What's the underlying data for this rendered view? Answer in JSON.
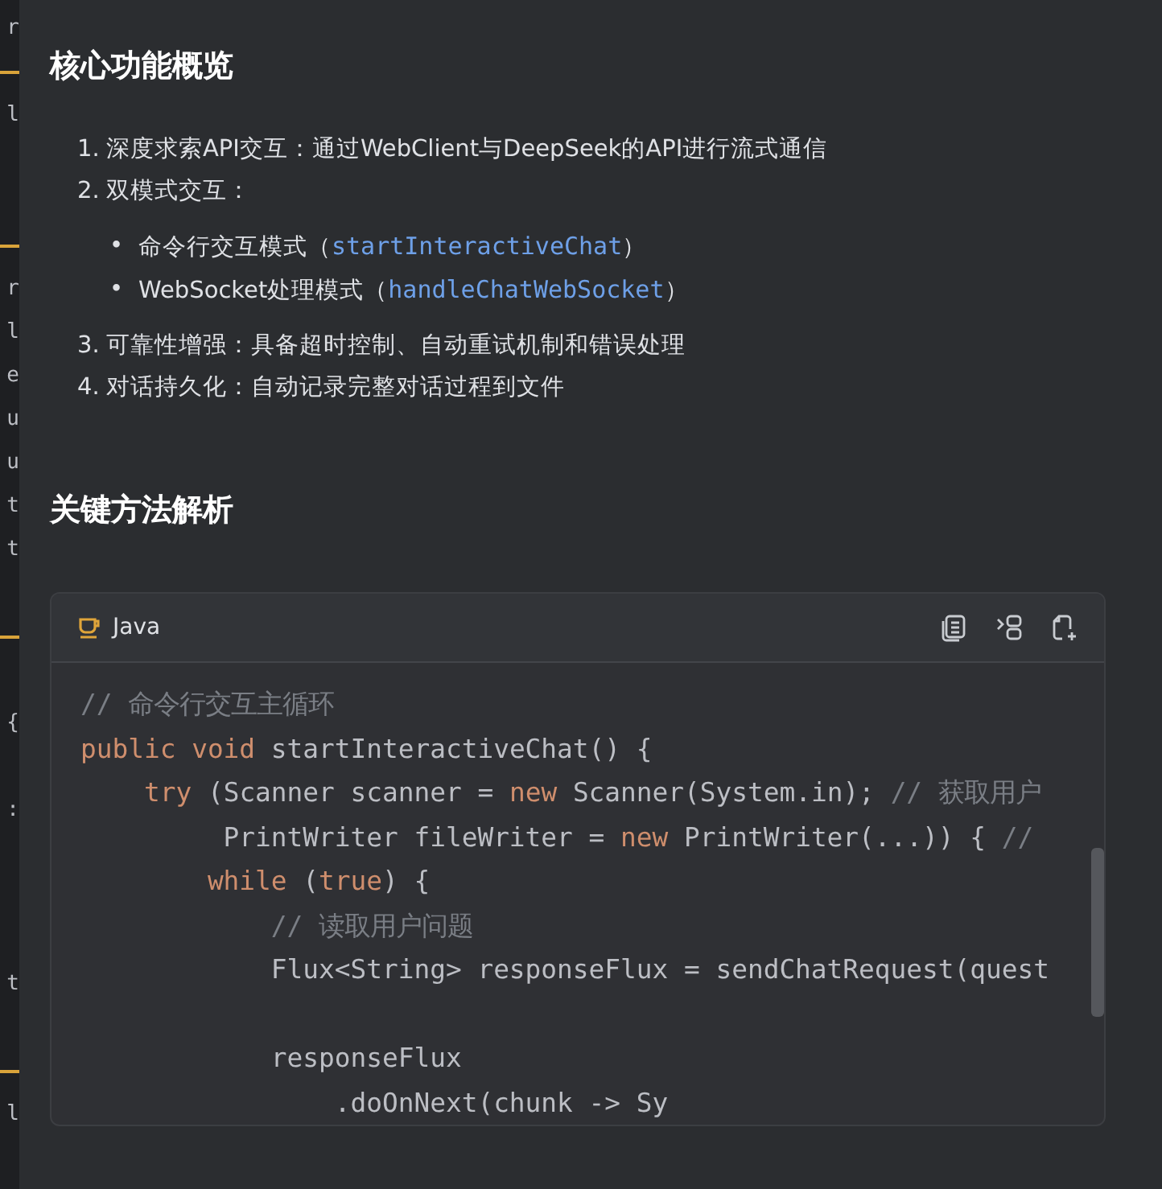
{
  "editor_strip": [
    {
      "kind": "text",
      "text": "r"
    },
    {
      "kind": "bar"
    },
    {
      "kind": "text",
      "text": "l"
    },
    {
      "kind": "blank"
    },
    {
      "kind": "blank"
    },
    {
      "kind": "bar"
    },
    {
      "kind": "text",
      "text": "r"
    },
    {
      "kind": "text",
      "text": "l"
    },
    {
      "kind": "text",
      "text": "e"
    },
    {
      "kind": "text",
      "text": "u"
    },
    {
      "kind": "text",
      "text": "u"
    },
    {
      "kind": "text",
      "text": "t"
    },
    {
      "kind": "text",
      "text": "t"
    },
    {
      "kind": "blank"
    },
    {
      "kind": "bar"
    },
    {
      "kind": "blank"
    },
    {
      "kind": "text",
      "text": "{"
    },
    {
      "kind": "blank"
    },
    {
      "kind": "text",
      "text": ":"
    },
    {
      "kind": "blank"
    },
    {
      "kind": "blank"
    },
    {
      "kind": "blank"
    },
    {
      "kind": "text",
      "text": "t"
    },
    {
      "kind": "blank"
    },
    {
      "kind": "bar"
    },
    {
      "kind": "text",
      "text": "l"
    }
  ],
  "sections": [
    {
      "heading": "核心功能概览",
      "items": [
        {
          "marker": "1.",
          "text": "深度求索API交互：通过WebClient与DeepSeek的API进行流式通信"
        },
        {
          "marker": "2.",
          "text": "双模式交互：",
          "children": [
            {
              "marker": "•",
              "text": "命令行交互模式（",
              "code": "startInteractiveChat",
              "after": "）"
            },
            {
              "marker": "•",
              "text": "WebSocket处理模式（",
              "code": "handleChatWebSocket",
              "after": "）"
            }
          ]
        },
        {
          "marker": "3.",
          "text": "可靠性增强：具备超时控制、自动重试机制和错误处理"
        },
        {
          "marker": "4.",
          "text": "对话持久化：自动记录完整对话过程到文件"
        }
      ]
    },
    {
      "heading": "关键方法解析"
    }
  ],
  "code_block": {
    "language": "Java",
    "lines": [
      {
        "kind": "code",
        "tokens": [
          {
            "kind": "comment",
            "text": "// 命令行交互主循环"
          }
        ]
      },
      {
        "kind": "code",
        "tokens": [
          {
            "kind": "keyword",
            "text": "public void "
          },
          {
            "kind": "plain",
            "text": "startInteractiveChat() {"
          }
        ]
      },
      {
        "kind": "code",
        "tokens": [
          {
            "kind": "keyword",
            "text": "    try "
          },
          {
            "kind": "plain",
            "text": "(Scanner scanner = "
          },
          {
            "kind": "keyword",
            "text": "new "
          },
          {
            "kind": "plain",
            "text": "Scanner(System.in); "
          },
          {
            "kind": "comment",
            "text": "// 获取用户"
          }
        ]
      },
      {
        "kind": "code",
        "tokens": [
          {
            "kind": "plain",
            "text": "         PrintWriter fileWriter = "
          },
          {
            "kind": "keyword",
            "text": "new "
          },
          {
            "kind": "plain",
            "text": "PrintWriter(...)) { "
          },
          {
            "kind": "comment",
            "text": "//"
          }
        ]
      },
      {
        "kind": "code",
        "tokens": [
          {
            "kind": "keyword",
            "text": "        while "
          },
          {
            "kind": "plain",
            "text": "("
          },
          {
            "kind": "keyword",
            "text": "true"
          },
          {
            "kind": "plain",
            "text": ") {"
          }
        ]
      },
      {
        "kind": "code",
        "tokens": [
          {
            "kind": "comment",
            "text": "            // 读取用户问题"
          }
        ]
      },
      {
        "kind": "code",
        "tokens": [
          {
            "kind": "plain",
            "text": "            Flux<String> responseFlux = sendChatRequest(quest"
          }
        ]
      },
      {
        "kind": "blank"
      },
      {
        "kind": "code",
        "tokens": [
          {
            "kind": "plain",
            "text": "            responseFlux"
          }
        ]
      },
      {
        "kind": "code",
        "tokens": [
          {
            "kind": "plain",
            "text": "                .doOnNext(chunk -> Sy"
          }
        ]
      }
    ]
  }
}
